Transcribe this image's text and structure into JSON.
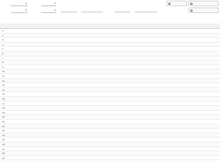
{
  "filters": {
    "row1": [
      {
        "key": "f1",
        "label": "",
        "value": ""
      },
      {
        "key": "f2",
        "label": "",
        "value": ""
      },
      {
        "key": "f3",
        "label": "",
        "value": ""
      },
      {
        "key": "f4",
        "label": "",
        "value": ""
      }
    ],
    "row2": [
      {
        "key": "f5",
        "label": "",
        "value": ""
      },
      {
        "key": "f6",
        "label": "",
        "value": ""
      }
    ],
    "range": {
      "from": "",
      "to": ""
    },
    "range2": {
      "from": "",
      "to": ""
    },
    "buttons": [
      {
        "key": "b1",
        "label": ""
      },
      {
        "key": "b2",
        "label": ""
      },
      {
        "key": "b3",
        "label": ""
      }
    ]
  },
  "table": {
    "columns": [
      "",
      "",
      "",
      "",
      "",
      "",
      "",
      "",
      "",
      "",
      "",
      ""
    ],
    "rows": [
      [
        "1",
        "",
        "",
        "",
        "",
        "",
        "",
        "",
        "",
        "",
        "",
        ""
      ],
      [
        "2",
        "",
        "",
        "",
        "",
        "",
        "",
        "",
        "",
        "",
        "",
        ""
      ],
      [
        "3",
        "",
        "",
        "",
        "",
        "",
        "",
        "",
        "",
        "",
        "",
        ""
      ],
      [
        "4",
        "",
        "",
        "",
        "",
        "",
        "",
        "",
        "",
        "",
        "",
        ""
      ],
      [
        "5",
        "",
        "",
        "",
        "",
        "",
        "",
        "",
        "",
        "",
        "",
        ""
      ],
      [
        "6",
        "",
        "",
        "",
        "",
        "",
        "",
        "",
        "",
        "",
        "",
        ""
      ],
      [
        "7",
        "",
        "",
        "",
        "",
        "",
        "",
        "",
        "",
        "",
        "",
        ""
      ],
      [
        "8",
        "",
        "",
        "",
        "",
        "",
        "",
        "",
        "",
        "",
        "",
        ""
      ],
      [
        "9",
        "",
        "",
        "",
        "",
        "",
        "",
        "",
        "",
        "",
        "",
        ""
      ],
      [
        "10",
        "",
        "",
        "",
        "",
        "",
        "",
        "",
        "",
        "",
        "",
        ""
      ],
      [
        "11",
        "",
        "",
        "",
        "",
        "",
        "",
        "",
        "",
        "",
        "",
        ""
      ],
      [
        "12",
        "",
        "",
        "",
        "",
        "",
        "",
        "",
        "",
        "",
        "",
        ""
      ],
      [
        "13",
        "",
        "",
        "",
        "",
        "",
        "",
        "",
        "",
        "",
        "",
        ""
      ],
      [
        "14",
        "",
        "",
        "",
        "",
        "",
        "",
        "",
        "",
        "",
        "",
        ""
      ],
      [
        "15",
        "",
        "",
        "",
        "",
        "",
        "",
        "",
        "",
        "",
        "",
        ""
      ],
      [
        "16",
        "",
        "",
        "",
        "",
        "",
        "",
        "",
        "",
        "",
        "",
        ""
      ],
      [
        "17",
        "",
        "",
        "",
        "",
        "",
        "",
        "",
        "",
        "",
        "",
        ""
      ],
      [
        "18",
        "",
        "",
        "",
        "",
        "",
        "",
        "",
        "",
        "",
        "",
        ""
      ],
      [
        "19",
        "",
        "",
        "",
        "",
        "",
        "",
        "",
        "",
        "",
        "",
        ""
      ],
      [
        "20",
        "",
        "",
        "",
        "",
        "",
        "",
        "",
        "",
        "",
        "",
        ""
      ],
      [
        "21",
        "",
        "",
        "",
        "",
        "",
        "",
        "",
        "",
        "",
        "",
        ""
      ],
      [
        "22",
        "",
        "",
        "",
        "",
        "",
        "",
        "",
        "",
        "",
        "",
        ""
      ],
      [
        "23",
        "",
        "",
        "",
        "",
        "",
        "",
        "",
        "",
        "",
        "",
        ""
      ],
      [
        "24",
        "",
        "",
        "",
        "",
        "",
        "",
        "",
        "",
        "",
        "",
        ""
      ],
      [
        "25",
        "",
        "",
        "",
        "",
        "",
        "",
        "",
        "",
        "",
        "",
        ""
      ],
      [
        "26",
        "",
        "",
        "",
        "",
        "",
        "",
        "",
        "",
        "",
        "",
        ""
      ],
      [
        "27",
        "",
        "",
        "",
        "",
        "",
        "",
        "",
        "",
        "",
        "",
        ""
      ],
      [
        "28",
        "",
        "",
        "",
        "",
        "",
        "",
        "",
        "",
        "",
        "",
        ""
      ],
      [
        "29",
        "",
        "",
        "",
        "",
        "",
        "",
        "",
        "",
        "",
        "",
        ""
      ]
    ]
  },
  "colors": {
    "header_bg": "#f2f2f2",
    "row_border": "#ececec",
    "text": "#444444"
  }
}
